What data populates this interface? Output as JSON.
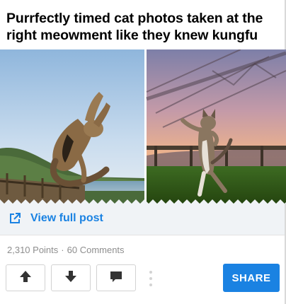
{
  "post": {
    "title": "Purrfectly timed cat photos taken at the right meowment like they knew kungfu"
  },
  "view_full": {
    "label": "View full post",
    "icon": "external-link-icon"
  },
  "stats": {
    "points": "2,310 Points",
    "separator": "·",
    "comments": "60 Comments"
  },
  "actions": {
    "upvote_icon": "arrow-up-icon",
    "downvote_icon": "arrow-down-icon",
    "comment_icon": "comment-bubble-icon",
    "more_icon": "vertical-dots-icon",
    "share_label": "SHARE"
  },
  "colors": {
    "accent": "#1a82e2",
    "view_full_bg": "#f0f3f6",
    "muted_text": "#8e8e8e",
    "button_border": "#d2d2d2"
  }
}
